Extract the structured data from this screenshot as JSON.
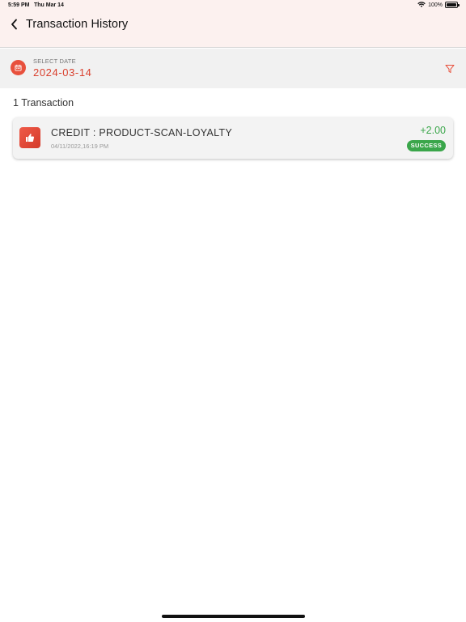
{
  "status_bar": {
    "time": "5:59 PM",
    "date": "Thu Mar 14",
    "battery": "100%",
    "icons": [
      "wifi-icon",
      "battery-icon"
    ]
  },
  "header": {
    "title": "Transaction History",
    "back_icon": "chevron-left-icon"
  },
  "date_selector": {
    "label": "SELECT DATE",
    "value": "2024-03-14",
    "icon": "calendar-icon",
    "filter_icon": "filter-icon"
  },
  "transactions": {
    "count_label": "1 Transaction",
    "items": [
      {
        "title": "CREDIT : PRODUCT-SCAN-LOYALTY",
        "timestamp": "04/11/2022,16:19 PM",
        "amount": "+2.00",
        "status": "SUCCESS",
        "icon": "thumbs-up-icon"
      }
    ]
  },
  "colors": {
    "accent": "#e8503c",
    "success": "#3aa64a",
    "header_bg": "#fcf1ef"
  }
}
